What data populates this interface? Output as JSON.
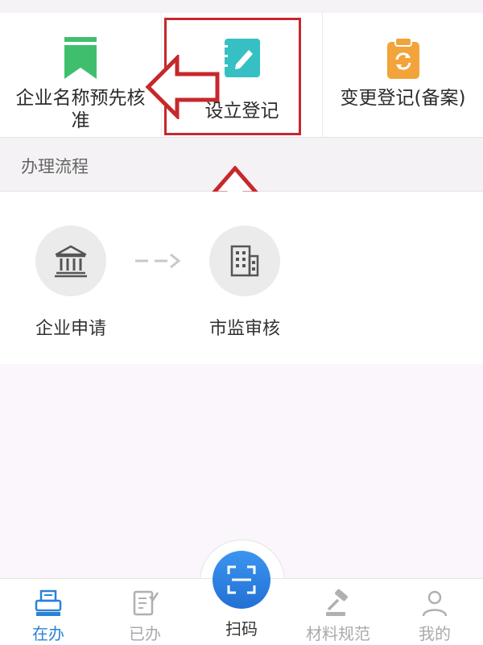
{
  "services": [
    {
      "id": "name-precheck",
      "label": "企业名称预先核准",
      "icon": "bookmark-icon",
      "color": "#3fbf6d"
    },
    {
      "id": "establish",
      "label": "设立登记",
      "icon": "notebook-pen-icon",
      "color": "#36c0c4"
    },
    {
      "id": "change",
      "label": "变更登记(备案)",
      "icon": "clipboard-refresh-icon",
      "color": "#f2a43a"
    }
  ],
  "section": {
    "title": "办理流程"
  },
  "process": {
    "steps": [
      {
        "label": "企业申请",
        "icon": "bank-building-icon"
      },
      {
        "label": "市监审核",
        "icon": "office-building-icon"
      }
    ]
  },
  "tabs": [
    {
      "label": "在办",
      "icon": "printer-icon",
      "active": true
    },
    {
      "label": "已办",
      "icon": "checked-doc-icon",
      "active": false
    },
    {
      "label": "扫码",
      "icon": "scan-icon",
      "active": false
    },
    {
      "label": "材料规范",
      "icon": "gavel-icon",
      "active": false
    },
    {
      "label": "我的",
      "icon": "user-icon",
      "active": false
    }
  ],
  "colors": {
    "accent": "#2b82d6",
    "annotation": "#c6282c"
  }
}
